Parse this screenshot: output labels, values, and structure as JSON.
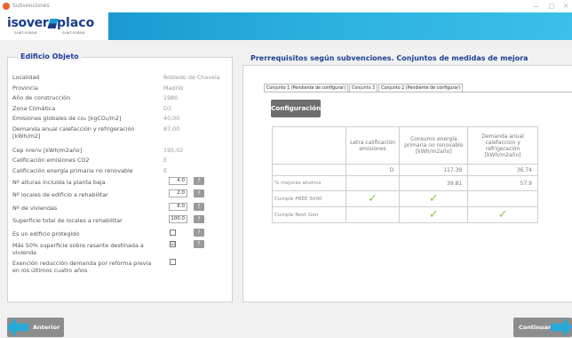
{
  "window": {
    "title": "Subvenciones",
    "controls": [
      "—",
      "□",
      "✕"
    ]
  },
  "brand": {
    "isover": "isover",
    "placo": "placo",
    "isover_sub": "SAINT-GOBAIN",
    "placo_sub": "SAINT-GOBAIN"
  },
  "left": {
    "title": "Edificio Objeto",
    "info": [
      {
        "label": "Localidad",
        "value": "Robledo de Chavela"
      },
      {
        "label": "Provincia",
        "value": "Madrid"
      },
      {
        "label": "Año de construcción",
        "value": "1980"
      },
      {
        "label": "Zona Climática",
        "value": "D3"
      },
      {
        "label": "Emisiones globales de co₂ [kgCO₂/m2]",
        "value": "40,00"
      },
      {
        "label": "Demanda anual calefacción y refrigeración [kWh/m2]",
        "value": "87,00"
      },
      {
        "label": "Cep nrenv [kWh/m2año]",
        "value": "195,02"
      },
      {
        "label": "Calificación emisiones CO2",
        "value": "E"
      },
      {
        "label": "Calificación energía primaria no renovable",
        "value": "E"
      }
    ],
    "fields": [
      {
        "label": "Nº alturas incluida la planta baja",
        "value": "4.0"
      },
      {
        "label": "Nº locales de edificio a rehabilitar",
        "value": "2.0"
      },
      {
        "label": "Nº de viviendas",
        "value": "8.0"
      },
      {
        "label": "Superficie total de locales a rehabilitar",
        "value": "100.0"
      }
    ],
    "checks": [
      {
        "label": "Es un edificio protegido",
        "checked": false,
        "mark": ""
      },
      {
        "label": "Más 50% superficie sobre rasante destinada a vivienda",
        "checked": true,
        "mark": "☑"
      },
      {
        "label": "Exención reducción demanda por reforma previa en los últimos cuatro años",
        "checked": false,
        "mark": ""
      }
    ],
    "help_label": "?"
  },
  "right": {
    "title": "Prerrequisitos según subvenciones. Conjuntos de medidas de mejora",
    "tabs": [
      "Conjunto 1 (Pendiente de configurar)",
      "Conjunto 3",
      "Conjunto 2 (Pendiente de configurar)"
    ],
    "active_tab": 1,
    "config_button": "Configuración",
    "table": {
      "headers": [
        "",
        "Letra calificación emisiones",
        "Consumo energía primaria no renovable [kWh/m2año]",
        "Demanda anual calefaccion y refrigeración [kWh/m2año]"
      ],
      "values_row": [
        "",
        "D",
        "117.39",
        "36.74"
      ],
      "savings_row": [
        "% mejoras ahorros",
        "",
        "39.81",
        "57.9"
      ],
      "pree_row": {
        "label": "Cumple PREE 5000",
        "checks": [
          "✓",
          "✓",
          ""
        ]
      },
      "nextgen_row": {
        "label": "Cumple Next Gen",
        "checks": [
          "",
          "✓",
          "✓"
        ]
      }
    }
  },
  "footer": {
    "prev": "Anterior",
    "next": "Continuar"
  },
  "colors": {
    "accent": "#27a9d6",
    "brand_blue": "#1c3f94",
    "check_green": "#8cc63f"
  }
}
